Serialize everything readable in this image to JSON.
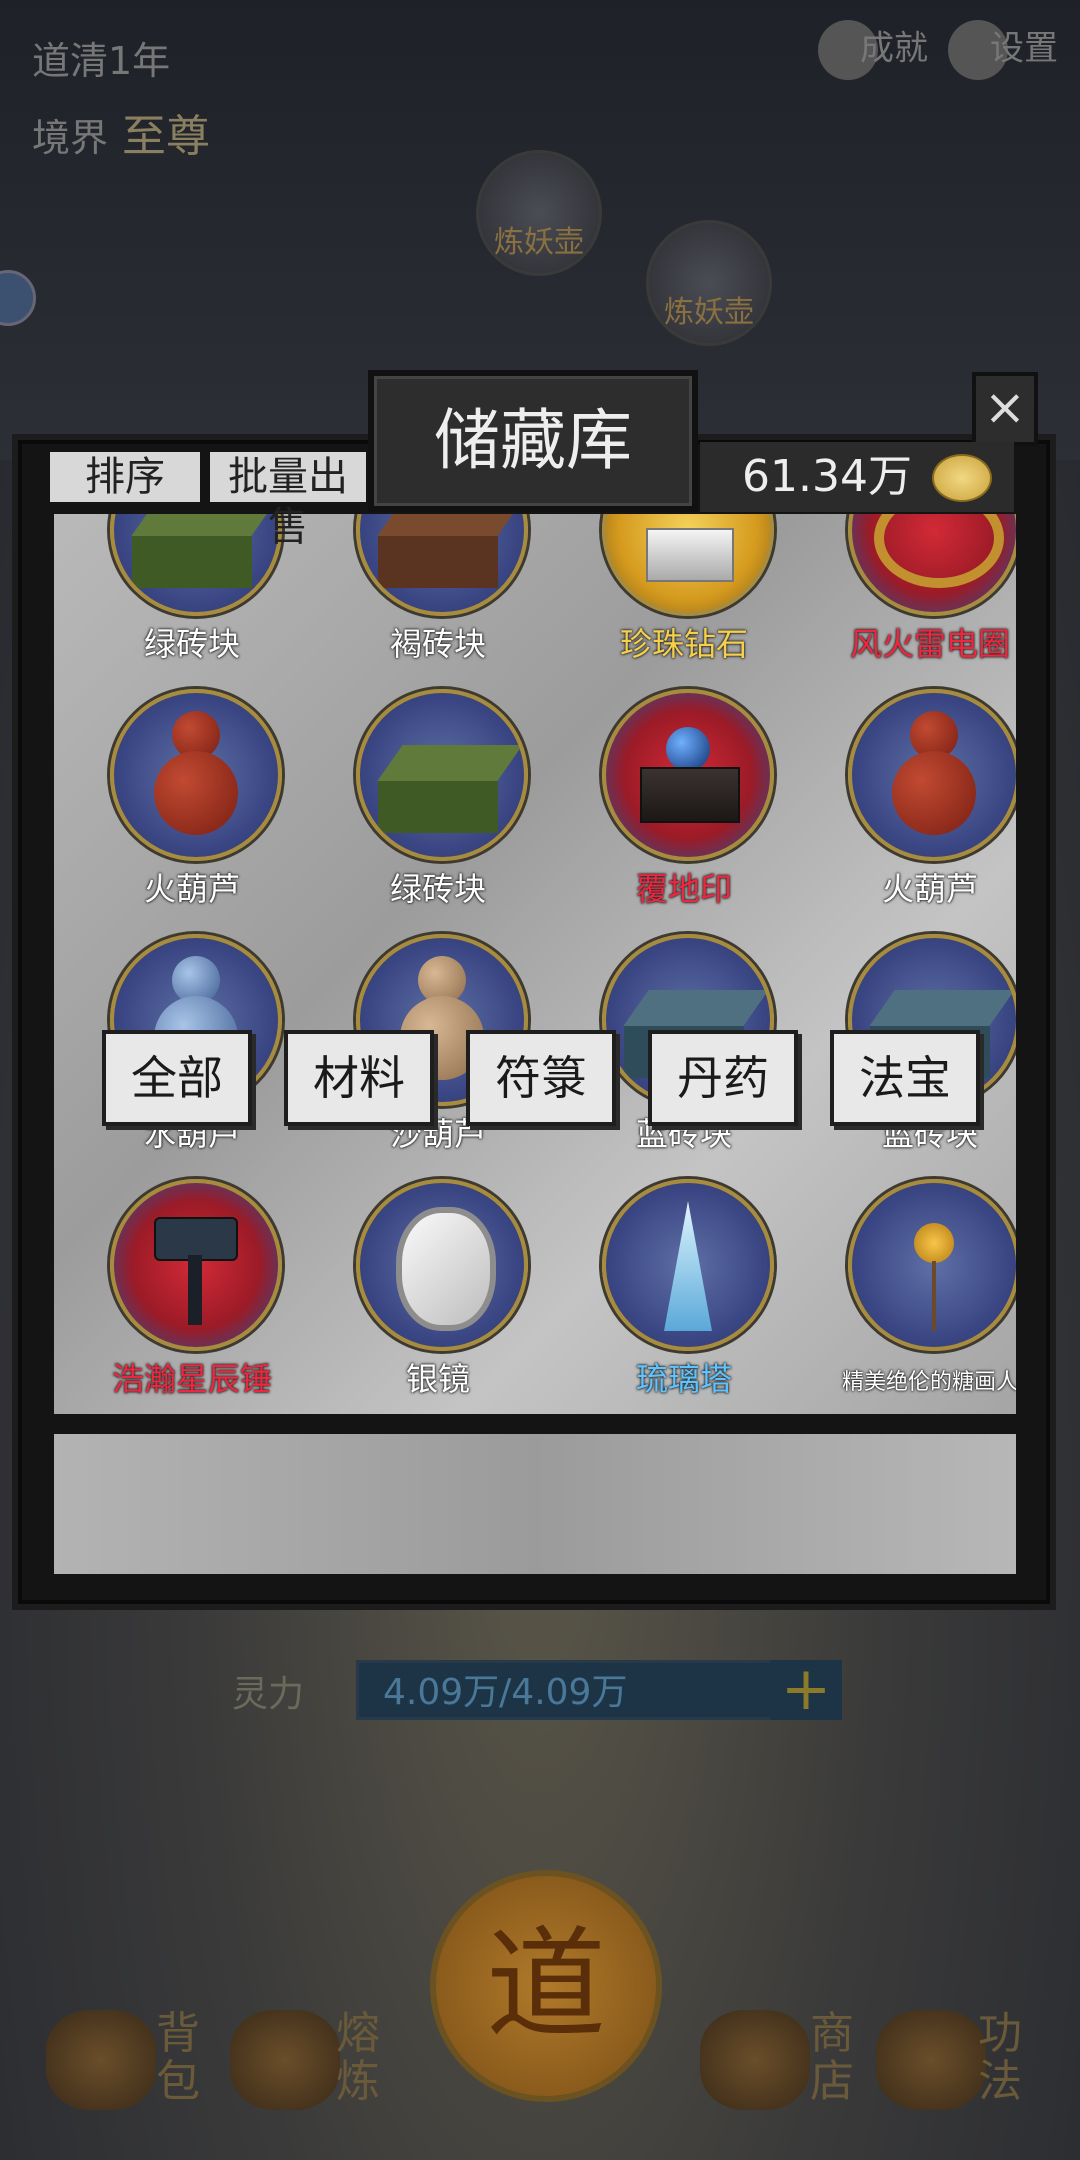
{
  "hud": {
    "time": "道清1年",
    "realm_label": "境界",
    "realm_value": "至尊",
    "achievements": "成就",
    "settings": "设置"
  },
  "background_nodes": [
    "炼妖壶",
    "炼妖壶"
  ],
  "storage": {
    "title": "储藏库",
    "close": "×",
    "sort_label": "排序",
    "bulk_sell_label": "批量出售",
    "money": "61.34万",
    "items": [
      {
        "name": "绿砖块",
        "color": "white",
        "icon": "green-brick"
      },
      {
        "name": "褐砖块",
        "color": "white",
        "icon": "brown-brick"
      },
      {
        "name": "珍珠钻石",
        "color": "yellow",
        "icon": "pearl-diamond"
      },
      {
        "name": "风火雷电圈",
        "color": "red",
        "icon": "fire-ring"
      },
      {
        "name": "火葫芦",
        "color": "white",
        "icon": "fire-gourd"
      },
      {
        "name": "绿砖块",
        "color": "white",
        "icon": "green-brick"
      },
      {
        "name": "覆地印",
        "color": "red",
        "icon": "earth-seal"
      },
      {
        "name": "火葫芦",
        "color": "white",
        "icon": "fire-gourd"
      },
      {
        "name": "水葫芦",
        "color": "white",
        "icon": "water-gourd"
      },
      {
        "name": "沙葫芦",
        "color": "white",
        "icon": "sand-gourd"
      },
      {
        "name": "蓝砖块",
        "color": "white",
        "icon": "blue-brick"
      },
      {
        "name": "蓝砖块",
        "color": "white",
        "icon": "blue-brick"
      },
      {
        "name": "浩瀚星辰锤",
        "color": "red",
        "icon": "star-hammer"
      },
      {
        "name": "银镜",
        "color": "white",
        "icon": "silver-mirror"
      },
      {
        "name": "琉璃塔",
        "color": "blue",
        "icon": "glass-pagoda"
      },
      {
        "name": "精美绝伦的糖画人",
        "color": "white",
        "icon": "sugar-figure"
      }
    ],
    "filters": [
      "全部",
      "材料",
      "符箓",
      "丹药",
      "法宝"
    ]
  },
  "spirit": {
    "label": "灵力",
    "value": "4.09万/4.09万",
    "plus": "+"
  },
  "nav": {
    "seal": "道",
    "bag": "背包",
    "smelt": "熔炼",
    "shop": "商店",
    "skills": "功法"
  }
}
